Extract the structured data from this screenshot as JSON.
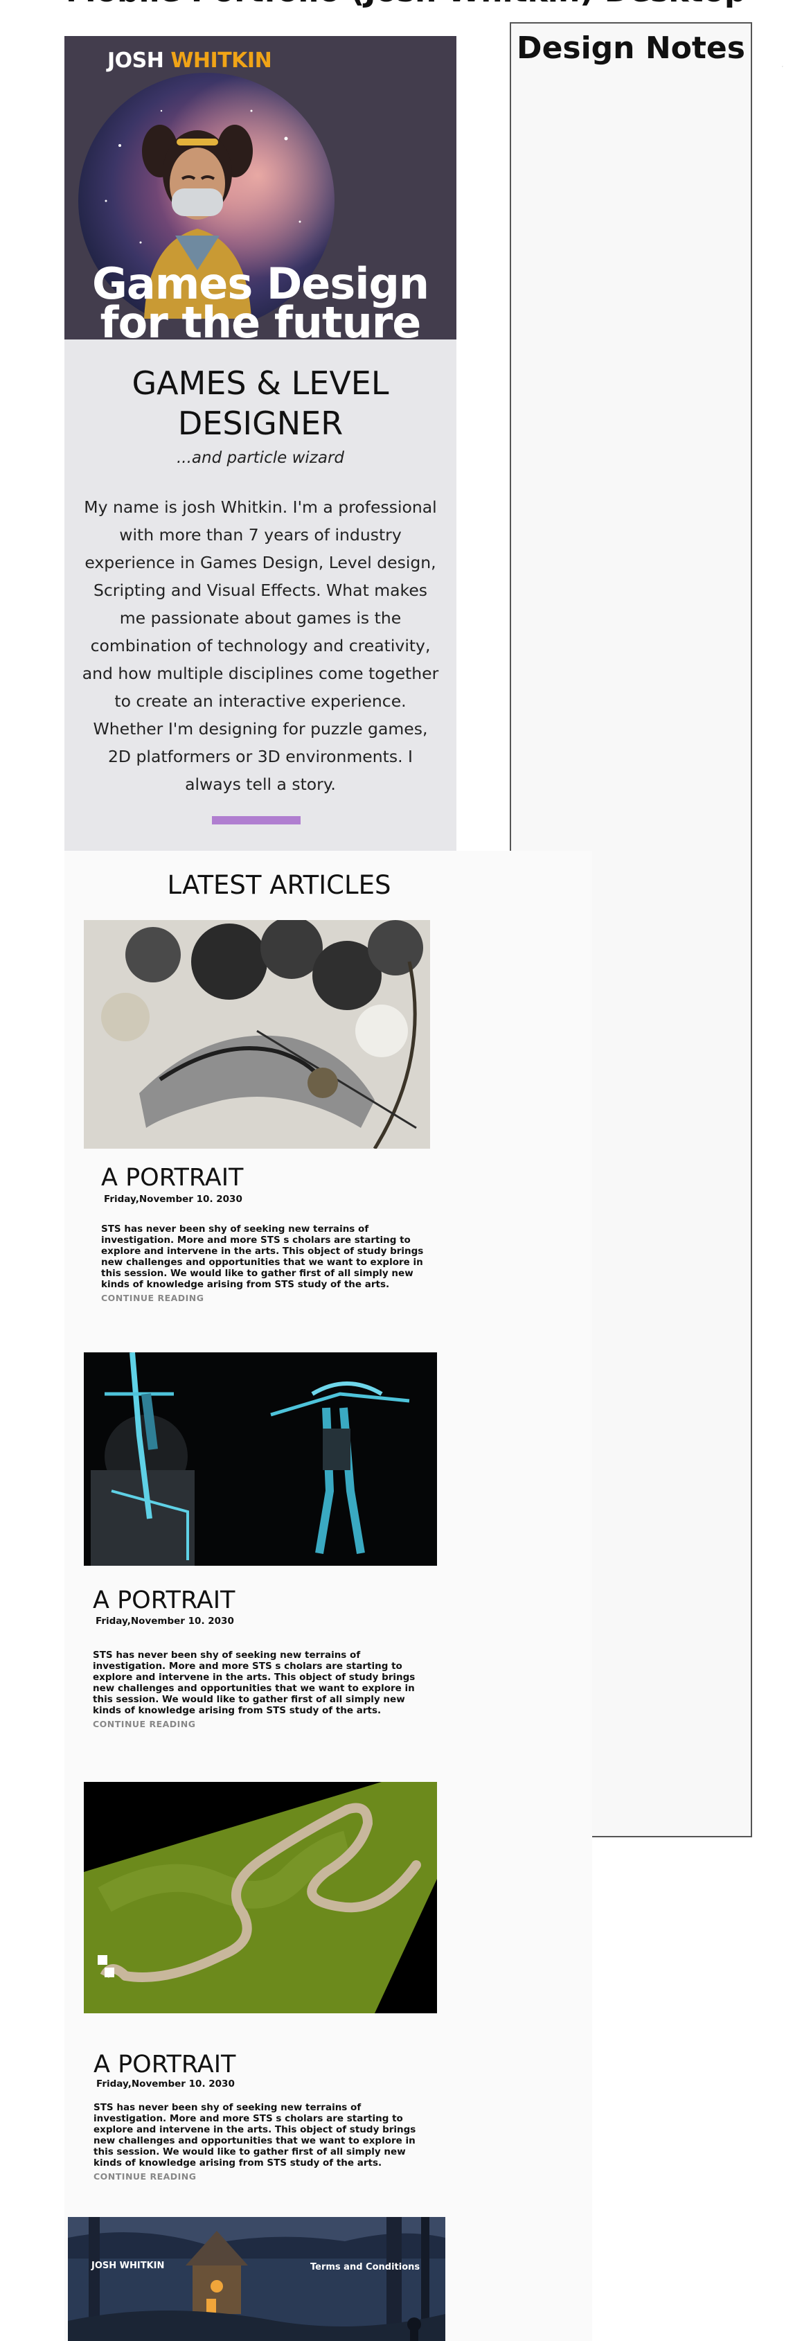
{
  "page": {
    "top_title": "Mobile Portfolio (Josh Whitkin) Desktop"
  },
  "design_notes": {
    "title": "Design Notes"
  },
  "hero": {
    "logo_first": "JOSH",
    "logo_last": "WHITKIN",
    "headline": "Games Design for the future"
  },
  "intro": {
    "role_title": "GAMES & LEVEL DESIGNER",
    "role_subtitle": "...and particle wizard",
    "bio": "My  name is josh Whitkin. I'm a professional with more than 7 years of industry experience in Games Design, Level design, Scripting and Visual Effects.  What makes me passionate about games is the combination of technology  and creativity, and how multiple disciplines come together to create an interactive experience. Whether I'm designing for puzzle games, 2D platformers or 3D environments. I always tell a story."
  },
  "articles": {
    "heading": "LATEST ARTICLES",
    "items": [
      {
        "title": "A PORTRAIT",
        "date": "Friday,November 10. 2030",
        "excerpt": "STS has never been shy of seeking new terrains of  investigation. More and  more  STS s cholars are  starting to explore and intervene in the arts.  This object of study  brings  new challenges and opportunities that we want  to explore in this session.  We would like to gather first of all simply  new kinds of  knowledge arising from  STS study  of the arts.",
        "link": "CONTINUE READING"
      },
      {
        "title": "A PORTRAIT",
        "date": "Friday,November 10. 2030",
        "excerpt": "STS has never been shy of seeking new terrains of  investigation. More and  more  STS s cholars are  starting to explore and intervene in the arts.  This object of study  brings  new challenges and opportunities that we want  to explore in this session.  We would like to gather first of all simply  new kinds of  knowledge arising from  STS study  of the arts.",
        "link": "CONTINUE READING"
      },
      {
        "title": "A PORTRAIT",
        "date": "Friday,November 10. 2030",
        "excerpt": "STS has never been shy of seeking new terrains of  investigation. More and  more  STS s cholars are  starting to explore and intervene in the arts.  This object of study  brings  new challenges and opportunities that we want  to explore in this session.  We would like to gather first of all simply  new kinds of  knowledge arising from  STS study  of the arts.",
        "link": "CONTINUE READING"
      }
    ]
  },
  "footer": {
    "brand": "JOSH WHITKIN",
    "terms_link": "Terms and Conditions"
  },
  "colors": {
    "hero_background": "#433d4d",
    "logo_accent": "#f0a417",
    "intro_background": "#e7e7ea",
    "divider_accent": "#b07ed0",
    "link_gray": "#888888"
  }
}
